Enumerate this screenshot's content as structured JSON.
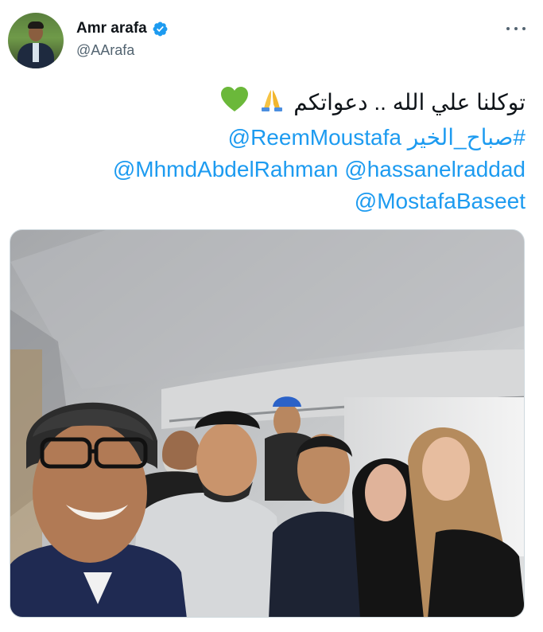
{
  "author": {
    "display_name": "Amr arafa",
    "handle": "@AArafa",
    "verified": true
  },
  "tweet": {
    "line1_text": "توكلنا علي الله .. دعواتكم",
    "line1_emojis": [
      "folded-hands-emoji",
      "green-heart-emoji"
    ],
    "line2_mention": "@ReemMoustafa",
    "line2_hashtag": "#صباح_الخير",
    "line3_mention_a": "@MhmdAbdelRahman",
    "line3_mention_b": "@hassanelraddad",
    "line4_mention": "@MostafaBaseet"
  },
  "media": {
    "type": "photo",
    "content": "group-selfie-airplane-cabin"
  },
  "colors": {
    "link": "#1d9bf0",
    "text": "#0f1419",
    "secondary": "#536471",
    "verified": "#1d9bf0"
  }
}
